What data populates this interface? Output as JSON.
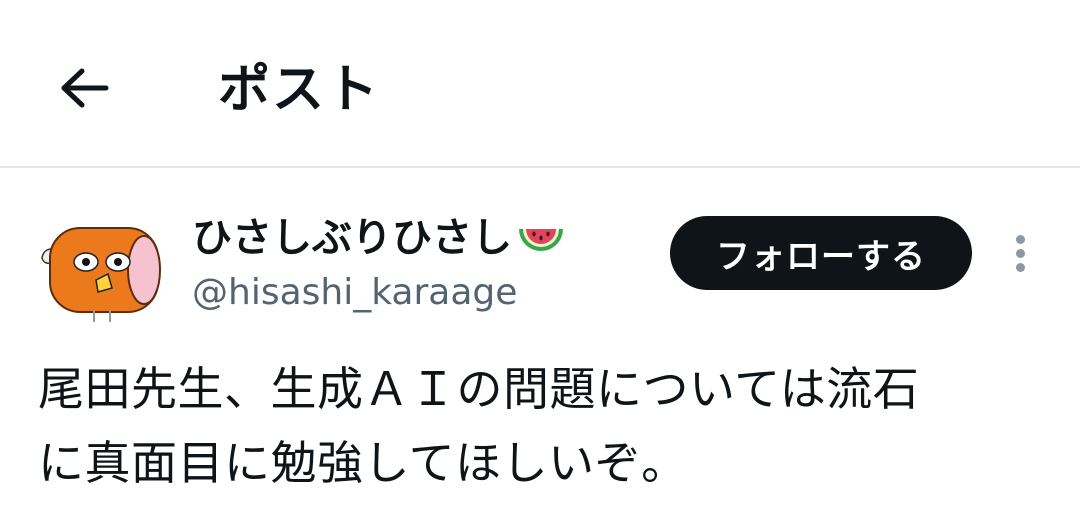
{
  "header": {
    "title": "ポスト",
    "back_icon": "arrow-left-icon"
  },
  "post": {
    "author": {
      "display_name": "ひさしぶりひさし",
      "name_emoji": "watermelon-icon",
      "handle": "@hisashi_karaage"
    },
    "follow_label": "フォローする",
    "more_icon": "more-vertical-icon",
    "text_line1": "尾田先生、生成ＡＩの問題については流石",
    "text_line2": "に真面目に勉強してほしいぞ。"
  },
  "colors": {
    "text": "#0f1419",
    "secondary": "#536471",
    "divider": "#e3e7ea",
    "button_bg": "#0f1419",
    "button_text": "#ffffff"
  }
}
